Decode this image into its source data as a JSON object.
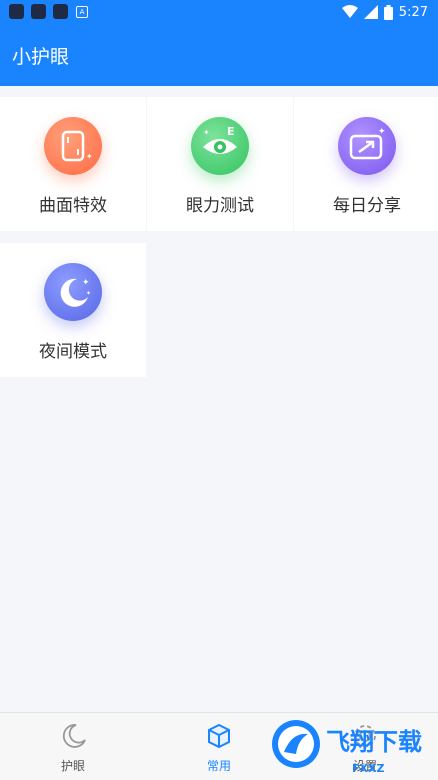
{
  "status_bar": {
    "time": "5:27",
    "battery_icon": "battery-icon",
    "wifi_icon": "wifi-icon",
    "signal_icon": "signal-icon"
  },
  "app_bar": {
    "title": "小护眼"
  },
  "features": [
    {
      "label": "曲面特效",
      "icon": "curved-screen-icon",
      "color": "#ff7a52"
    },
    {
      "label": "眼力测试",
      "icon": "eye-test-icon",
      "color": "#3ec96d"
    },
    {
      "label": "每日分享",
      "icon": "share-icon",
      "color": "#8b63f0"
    },
    {
      "label": "夜间模式",
      "icon": "moon-icon",
      "color": "#5a6ff0"
    }
  ],
  "bottom_nav": {
    "tabs": [
      {
        "label": "护眼",
        "icon": "moon-outline-icon",
        "active": false
      },
      {
        "label": "常用",
        "icon": "cube-icon",
        "active": true
      },
      {
        "label": "设置",
        "icon": "gear-icon",
        "active": false
      }
    ],
    "accent": "#1a84ff"
  },
  "watermark": {
    "text": "飞翔下载",
    "sub": "FXXZ"
  }
}
